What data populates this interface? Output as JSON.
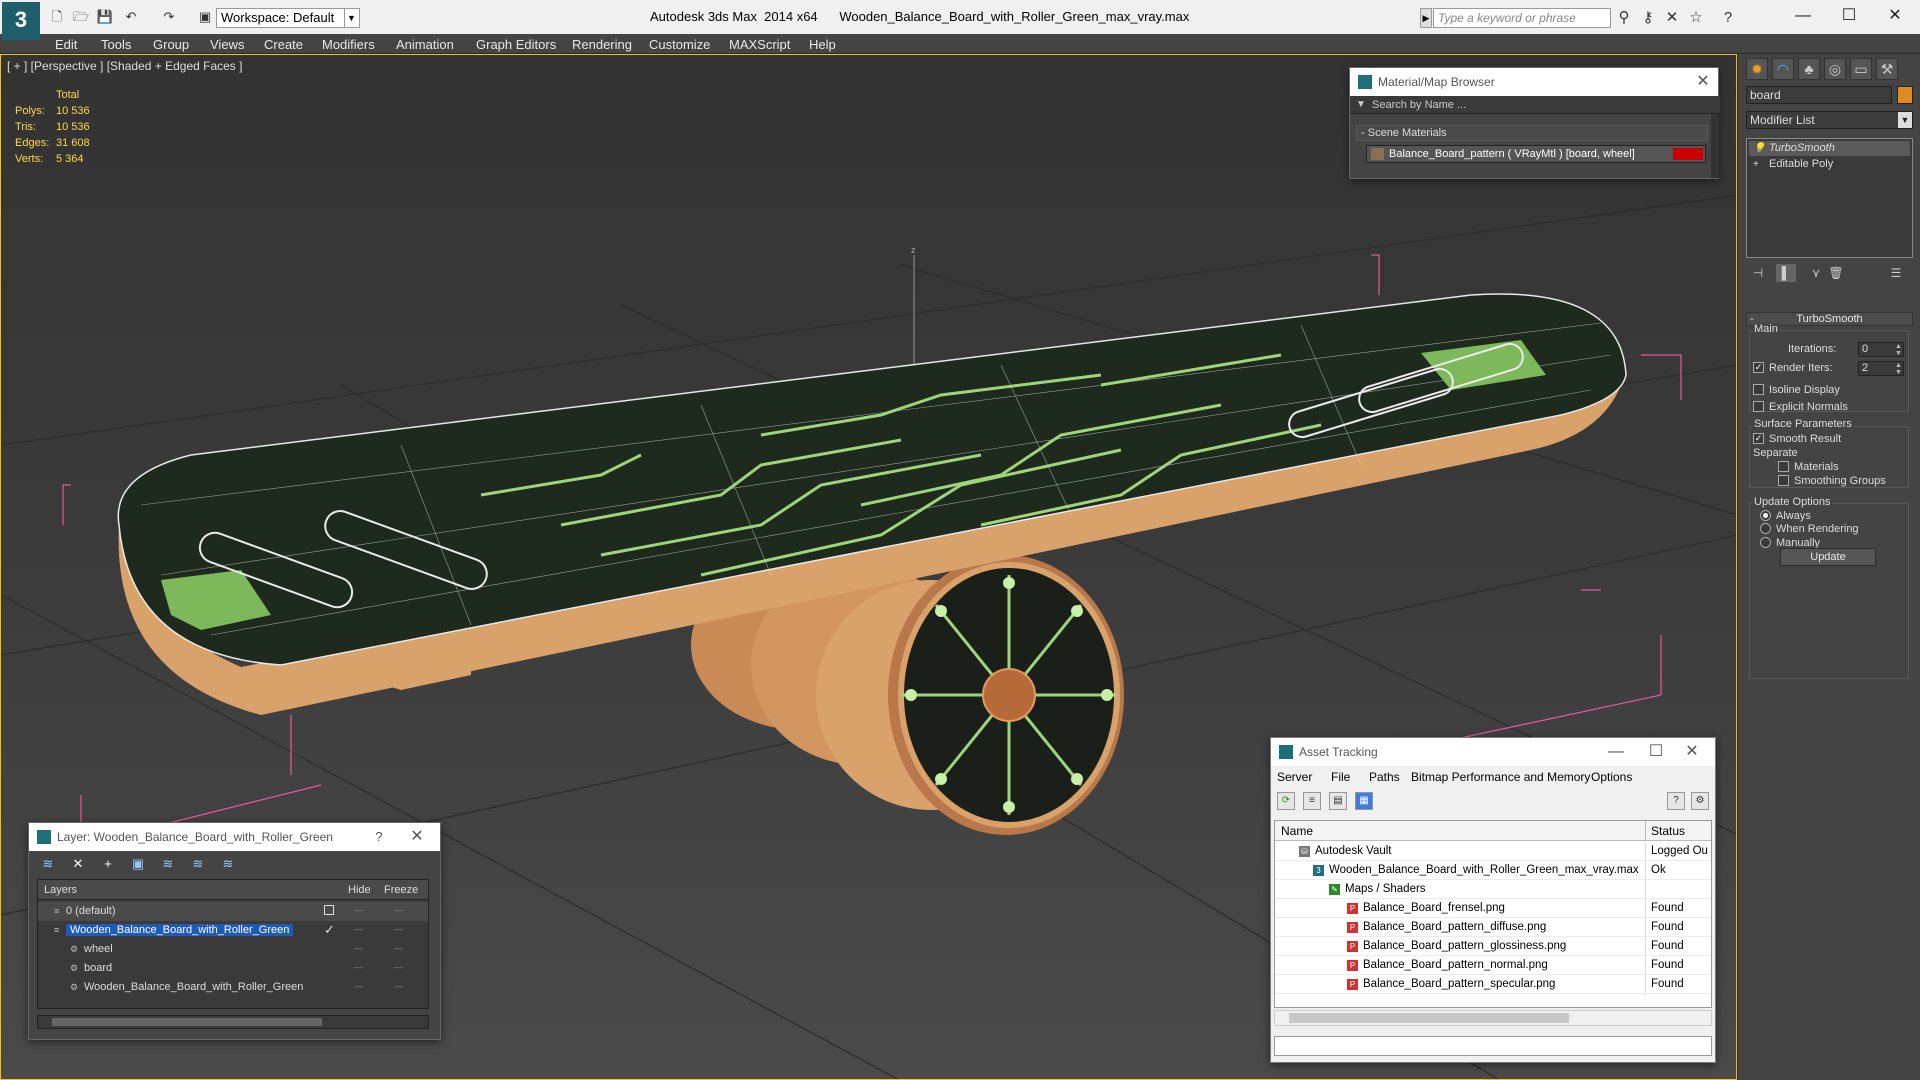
{
  "titlebar": {
    "app_name": "Autodesk 3ds Max  2014 x64",
    "file_name": "Wooden_Balance_Board_with_Roller_Green_max_vray.max",
    "workspace": "Workspace: Default",
    "search_placeholder": "Type a keyword or phrase"
  },
  "menu": {
    "items": [
      "Edit",
      "Tools",
      "Group",
      "Views",
      "Create",
      "Modifiers",
      "Animation",
      "Graph Editors",
      "Rendering",
      "Customize",
      "MAXScript",
      "Help"
    ]
  },
  "viewport": {
    "label": "[ + ] [Perspective ] [Shaded + Edged Faces ]",
    "stats": {
      "header": "Total",
      "rows": [
        {
          "label": "Polys:",
          "value": "10 536"
        },
        {
          "label": "Tris:",
          "value": "10 536"
        },
        {
          "label": "Edges:",
          "value": "31 608"
        },
        {
          "label": "Verts:",
          "value": "5 364"
        }
      ]
    },
    "gizmo_axis": "z"
  },
  "command_panel": {
    "object_name": "board",
    "modifier_list": "Modifier List",
    "stack": [
      "TurboSmooth",
      "Editable Poly"
    ],
    "rollout_title": "TurboSmooth",
    "main_group": "Main",
    "iterations_label": "Iterations:",
    "iterations_value": "0",
    "render_iters_label": "Render Iters:",
    "render_iters_value": "2",
    "isoline_display": "Isoline Display",
    "explicit_normals": "Explicit Normals",
    "surface_params": "Surface Parameters",
    "smooth_result": "Smooth Result",
    "separate": "Separate",
    "materials": "Materials",
    "smoothing_groups": "Smoothing Groups",
    "update_options": "Update Options",
    "always": "Always",
    "when_rendering": "When Rendering",
    "manually": "Manually",
    "update_button": "Update"
  },
  "material_browser": {
    "title": "Material/Map Browser",
    "search_placeholder": "Search by Name ...",
    "section": "Scene Materials",
    "item": "Balance_Board_pattern  ( VRayMtl )  [board, wheel]"
  },
  "asset_tracking": {
    "title": "Asset Tracking",
    "menu": [
      "Server",
      "File",
      "Paths",
      "Bitmap Performance and Memory",
      "Options"
    ],
    "columns": [
      "Name",
      "Status"
    ],
    "rows": [
      {
        "name": "Autodesk Vault",
        "status": "Logged Ou"
      },
      {
        "name": "Wooden_Balance_Board_with_Roller_Green_max_vray.max",
        "status": "Ok"
      },
      {
        "name": "Maps / Shaders",
        "status": ""
      },
      {
        "name": "Balance_Board_frensel.png",
        "status": "Found"
      },
      {
        "name": "Balance_Board_pattern_diffuse.png",
        "status": "Found"
      },
      {
        "name": "Balance_Board_pattern_glossiness.png",
        "status": "Found"
      },
      {
        "name": "Balance_Board_pattern_normal.png",
        "status": "Found"
      },
      {
        "name": "Balance_Board_pattern_specular.png",
        "status": "Found"
      }
    ]
  },
  "layer_manager": {
    "title": "Layer: Wooden_Balance_Board_with_Roller_Green",
    "help": "?",
    "columns": [
      "Layers",
      "Hide",
      "Freeze"
    ],
    "rows": [
      {
        "name": "0 (default)"
      },
      {
        "name": "Wooden_Balance_Board_with_Roller_Green"
      },
      {
        "name": "wheel"
      },
      {
        "name": "board"
      },
      {
        "name": "Wooden_Balance_Board_with_Roller_Green"
      }
    ]
  },
  "colors": {
    "viewport_border": "#f5c400",
    "stats_text": "#ffd84a",
    "selection": "#1e5bb8",
    "wood": "#d9a26a",
    "board_top": "#1e2a1e",
    "circuit": "#9fd47a",
    "bbox": "#e85a9a"
  }
}
